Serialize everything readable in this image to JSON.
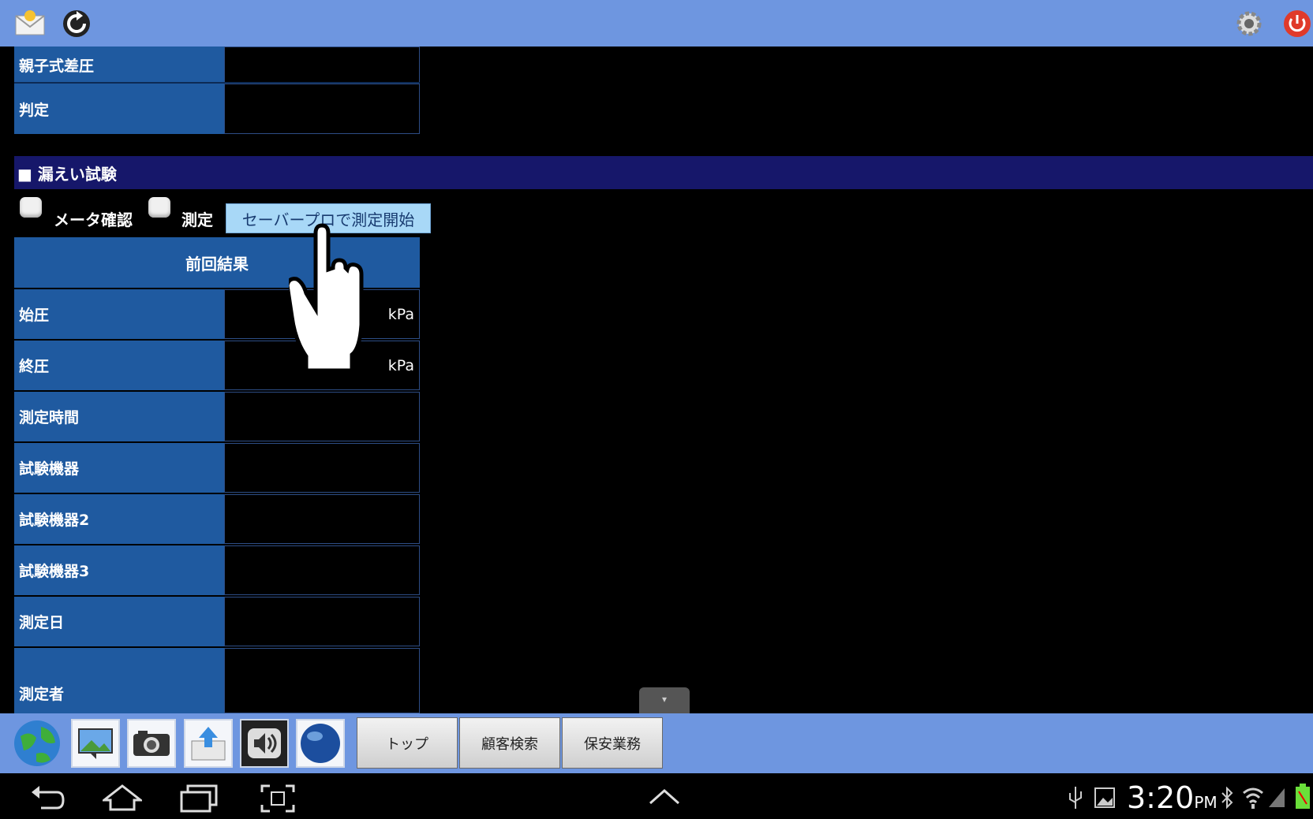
{
  "topbar": {
    "mail_icon": "mail-icon",
    "refresh_icon": "refresh-icon",
    "settings_icon": "gear-icon",
    "power_icon": "power-icon"
  },
  "upper_rows": [
    {
      "label": "親子式差圧",
      "value": ""
    },
    {
      "label": "判定",
      "value": ""
    }
  ],
  "section": {
    "title": "■ 漏えい試験"
  },
  "controls": {
    "meter_check_label": "メータ確認",
    "measure_label": "測定",
    "start_button": "セーバープロで測定開始"
  },
  "results": {
    "header": "前回結果",
    "rows": [
      {
        "label": "始圧",
        "value": "kPa"
      },
      {
        "label": "終圧",
        "value": "kPa"
      },
      {
        "label": "測定時間",
        "value": ""
      },
      {
        "label": "試験機器",
        "value": ""
      },
      {
        "label": "試験機器2",
        "value": ""
      },
      {
        "label": "試験機器3",
        "value": ""
      },
      {
        "label": "測定日",
        "value": ""
      },
      {
        "label": "測定者",
        "value": ""
      }
    ]
  },
  "tray": {
    "icons": [
      "globe-icon",
      "slideshow-icon",
      "camera-icon",
      "upload-icon",
      "speaker-icon",
      "earth-icon"
    ],
    "nav_buttons": [
      "トップ",
      "顧客検索",
      "保安業務"
    ]
  },
  "system": {
    "time": "3:20",
    "ampm": "PM"
  },
  "colors": {
    "topbar": "#6e96e0",
    "label_bg": "#1f5aa0",
    "section_bg": "#16176a",
    "button_bg": "#a8d8f7"
  }
}
